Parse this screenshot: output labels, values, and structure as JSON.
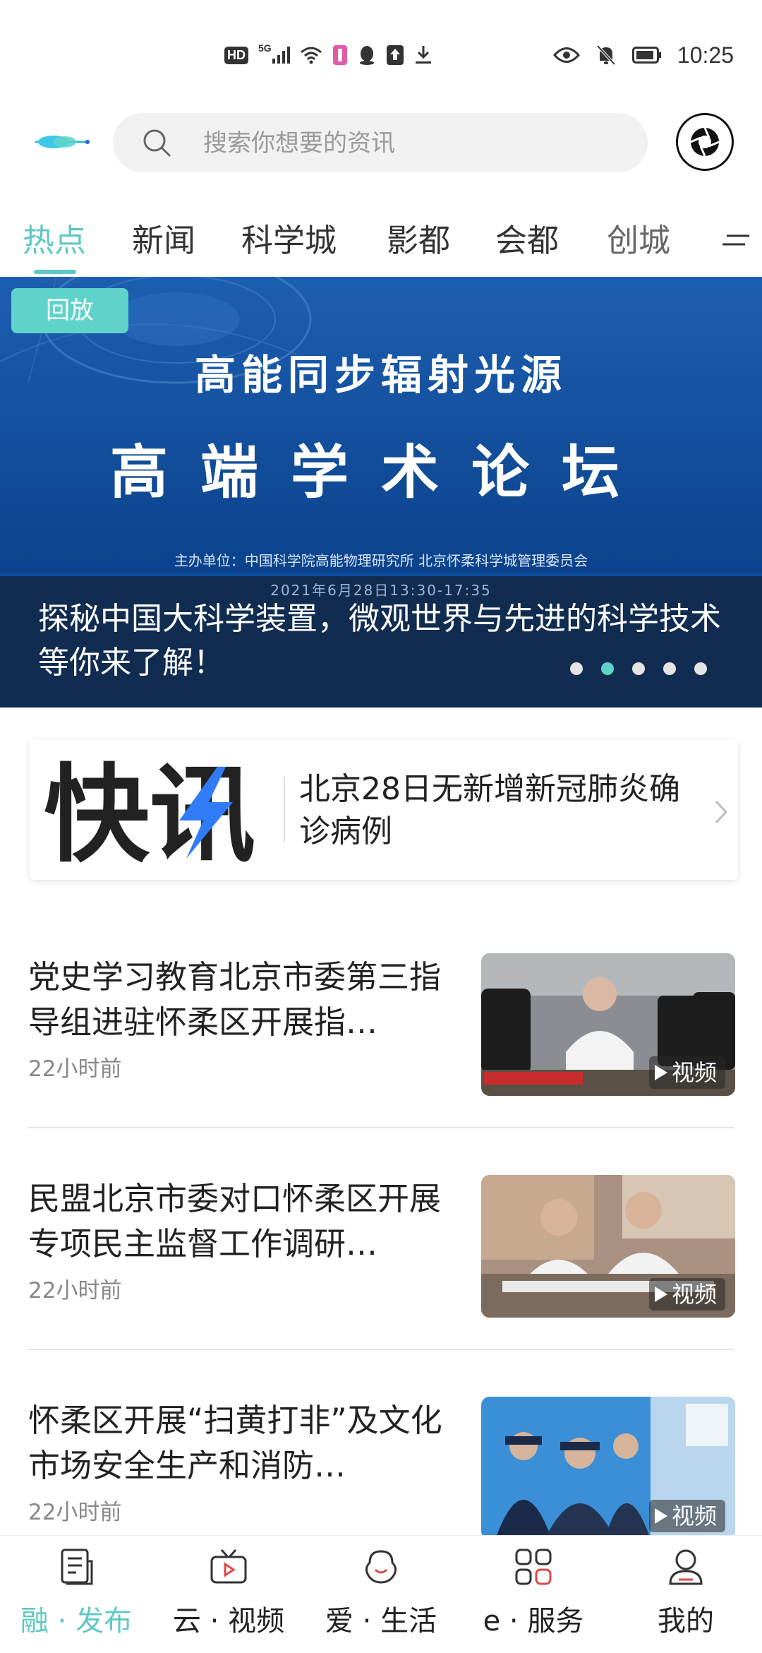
{
  "status_bar": {
    "hd_label": "HD",
    "network_label": "5G",
    "time": "10:25"
  },
  "header": {
    "search_placeholder": "搜索你想要的资讯",
    "icons": [
      "logo-wave-icon",
      "search-icon",
      "camera-shutter-icon"
    ]
  },
  "tabs": [
    {
      "label": "热点",
      "active": true
    },
    {
      "label": "新闻",
      "active": false
    },
    {
      "label": "科学城",
      "active": false
    },
    {
      "label": "影都",
      "active": false
    },
    {
      "label": "会都",
      "active": false
    },
    {
      "label": "创城",
      "active": false
    }
  ],
  "banner": {
    "badge": "回放",
    "title_line1": "高能同步辐射光源",
    "title_line2": "高端学术论坛",
    "organizer": "主办单位：中国科学院高能物理研究所  北京怀柔科学城管理委员会",
    "date": "2021年6月28日13:30-17:35",
    "caption": "探秘中国大科学装置，微观世界与先进的科学技术等你来了解！",
    "slide_count": 5,
    "active_slide": 2
  },
  "flash": {
    "logo_text": "快讯",
    "text": "北京28日无新增新冠肺炎确诊病例"
  },
  "news": [
    {
      "title": "党史学习教育北京市委第三指导组进驻怀柔区开展指…",
      "time": "22小时前",
      "badge": "视频"
    },
    {
      "title": "民盟北京市委对口怀柔区开展专项民主监督工作调研…",
      "time": "22小时前",
      "badge": "视频"
    },
    {
      "title": "怀柔区开展“扫黄打非”及文化市场安全生产和消防…",
      "time": "22小时前",
      "badge": "视频"
    }
  ],
  "bottom_nav": [
    {
      "label": "融 · 发布",
      "active": true,
      "icon": "document-icon"
    },
    {
      "label": "云 · 视频",
      "active": false,
      "icon": "tv-icon"
    },
    {
      "label": "爱 · 生活",
      "active": false,
      "icon": "smile-icon"
    },
    {
      "label": "e · 服务",
      "active": false,
      "icon": "grid-icon"
    },
    {
      "label": "我的",
      "active": false,
      "icon": "person-icon"
    }
  ],
  "colors": {
    "accent": "#5fc9c3",
    "banner_blue": "#0d4fa0",
    "nav_red": "#e04848"
  }
}
